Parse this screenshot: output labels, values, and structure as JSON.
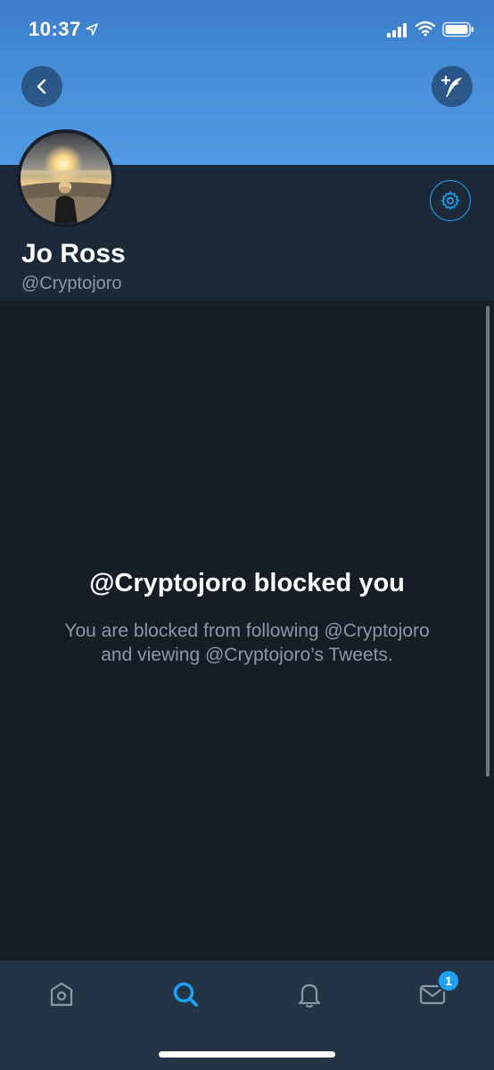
{
  "status_bar": {
    "time": "10:37"
  },
  "profile": {
    "display_name": "Jo Ross",
    "handle": "@Cryptojoro"
  },
  "blocked": {
    "title": "@Cryptojoro blocked you",
    "message": "You are blocked from following @Cryptojoro and viewing @Cryptojoro’s Tweets."
  },
  "tab_bar": {
    "items": [
      {
        "icon": "home-icon",
        "active": false
      },
      {
        "icon": "search-icon",
        "active": true
      },
      {
        "icon": "bell-icon",
        "active": false
      },
      {
        "icon": "mail-icon",
        "active": false
      }
    ],
    "messages_badge": "1"
  },
  "colors": {
    "accent": "#1da1f2",
    "banner": "#4a93dc",
    "background": "#161d27",
    "tab_bar": "#243447",
    "secondary_text": "#8899a6"
  }
}
